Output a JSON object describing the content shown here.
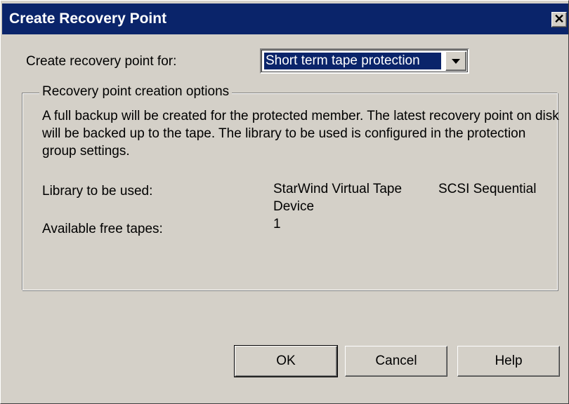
{
  "window": {
    "title": "Create Recovery Point",
    "close_glyph": "✕"
  },
  "form": {
    "create_for_label": "Create recovery point for:",
    "create_for_value": "Short term tape protection"
  },
  "group": {
    "legend": "Recovery point creation options",
    "description": "A full backup will be created for the protected member. The latest recovery point on disk will be backed up to the tape. The library to be used is configured in the protection group settings.",
    "library_label": "Library to be used:",
    "library_value_1": "StarWind Virtual Tape",
    "library_value_2": "Device",
    "library_value_3": "SCSI Sequential",
    "free_tapes_label": "Available free tapes:",
    "free_tapes_value": "1"
  },
  "buttons": {
    "ok": "OK",
    "cancel": "Cancel",
    "help": "Help"
  },
  "colors": {
    "titlebar": "#0a246a",
    "face": "#d4d0c8",
    "selection": "#0a246a"
  },
  "icons": {
    "close": "close-icon",
    "dropdown": "chevron-down-icon"
  }
}
